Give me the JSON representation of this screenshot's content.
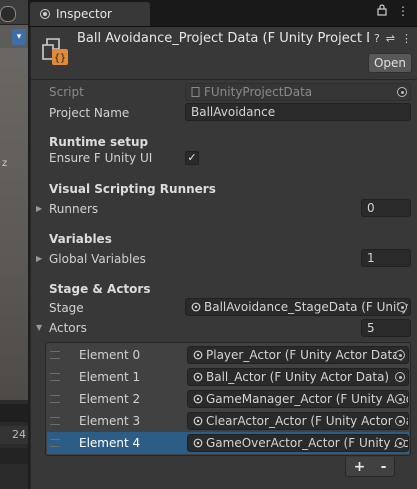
{
  "scene": {
    "side_number": "24"
  },
  "tab": {
    "label": "Inspector"
  },
  "header": {
    "title": "Ball Avoidance_Project Data (F Unity Project Data)",
    "open_label": "Open"
  },
  "fields": {
    "script_label": "Script",
    "script_value": "FUnityProjectData",
    "project_name_label": "Project Name",
    "project_name_value": "BallAvoidance"
  },
  "runtime": {
    "heading": "Runtime setup",
    "ensure_label": "Ensure F Unity UI",
    "ensure_checked": true,
    "check_glyph": "✓"
  },
  "runners": {
    "heading": "Visual Scripting Runners",
    "label": "Runners",
    "count": "0"
  },
  "variables": {
    "heading": "Variables",
    "label": "Global Variables",
    "count": "1"
  },
  "stage": {
    "heading": "Stage & Actors",
    "stage_label": "Stage",
    "stage_value": "BallAvoidance_StageData (F Unity Stage Data)",
    "actors_label": "Actors",
    "actors_count": "5"
  },
  "actors": [
    {
      "label": "Element 0",
      "value": "Player_Actor (F Unity Actor Data)"
    },
    {
      "label": "Element 1",
      "value": "Ball_Actor (F Unity Actor Data)"
    },
    {
      "label": "Element 2",
      "value": "GameManager_Actor (F Unity Actor Data)"
    },
    {
      "label": "Element 3",
      "value": "ClearActor_Actor (F Unity Actor Data)"
    },
    {
      "label": "Element 4",
      "value": "GameOverActor_Actor (F Unity Actor Data)"
    }
  ],
  "list_buttons": {
    "add": "+",
    "remove": "-"
  },
  "icons": {
    "tab": "inspector-icon",
    "lock": "lock-icon",
    "menu": "kebab-menu-icon",
    "asset": "scriptable-object-icon",
    "help": "help-icon",
    "settings": "sliders-icon",
    "more": "more-icon",
    "object": "object-field-icon",
    "picker": "object-picker-icon"
  },
  "colors": {
    "selection": "#2c5d87",
    "panel": "#383838",
    "field": "#2a2a2a",
    "asset_accent": "#e08a3a"
  }
}
